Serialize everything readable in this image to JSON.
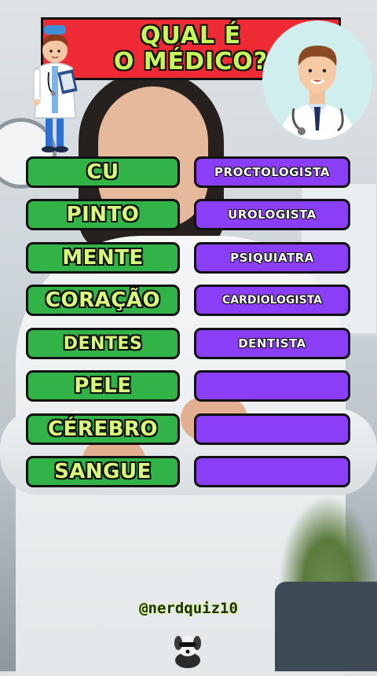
{
  "title": {
    "line1": "QUAL É",
    "line2": "O MÉDICO?"
  },
  "colors": {
    "title_bg": "#ee2a34",
    "title_text": "#c6f85a",
    "word_bg": "#31b347",
    "word_text": "#d8f87c",
    "answer_bg": "#8a3ef5"
  },
  "icons": {
    "left": "doctor-cartoon-icon",
    "right": "doctor-avatar-icon",
    "footer": "dog-mascot-icon"
  },
  "rows": [
    {
      "word": "CU",
      "answer": "PROCTOLOGISTA"
    },
    {
      "word": "PINTO",
      "answer": "UROLOGISTA"
    },
    {
      "word": "MENTE",
      "answer": "PSIQUIATRA"
    },
    {
      "word": "CORAÇÃO",
      "answer": "CARDIOLOGISTA"
    },
    {
      "word": "DENTES",
      "answer": "DENTISTA"
    },
    {
      "word": "PELE",
      "answer": ""
    },
    {
      "word": "CÉREBRO",
      "answer": ""
    },
    {
      "word": "SANGUE",
      "answer": ""
    }
  ],
  "footer": {
    "handle": "@nerdquiz10"
  }
}
